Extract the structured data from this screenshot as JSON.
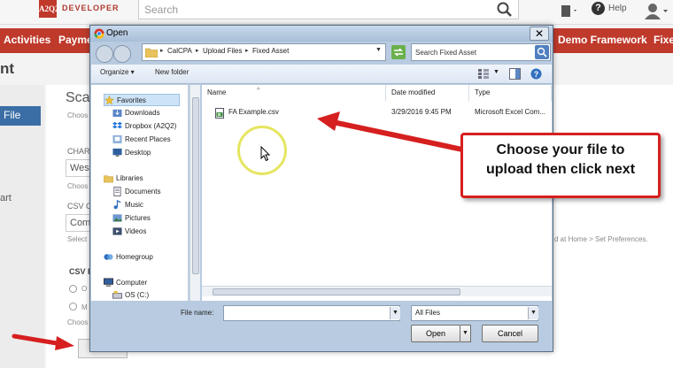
{
  "app": {
    "logo_mark": "A2Q2",
    "logo_text": "DEVELOPER",
    "search_placeholder": "Search",
    "help_label": "Help"
  },
  "nav": {
    "items": [
      "Activities",
      "Payme",
      "Demo Framework",
      "Fixe"
    ]
  },
  "page": {
    "title_fragment": "nt",
    "left_tab_label": "File",
    "left_art_label": "art",
    "section_fragment": "Sca",
    "choose_fragment_1": "Choos",
    "char_label_fragment": "CHAR",
    "char_value_fragment": "West",
    "choose_fragment_2": "Choos",
    "csv_label_fragment": "CSV C",
    "csv_value_fragment": "Com",
    "select_fragment": "Select",
    "csvf_label_fragment": "CSV F",
    "radio1_fragment": "O",
    "radio2_fragment": "M",
    "choose_fragment_3": "Choos",
    "preferences_hint": "d at Home > Set Preferences."
  },
  "dialog": {
    "title": "Open",
    "breadcrumbs": [
      "CalCPA",
      "Upload Files",
      "Fixed Asset"
    ],
    "search_placeholder": "Search Fixed Asset",
    "organize_label": "Organize ▾",
    "new_folder_label": "New folder",
    "nav_items": [
      {
        "label": "Favorites",
        "icon": "star-icon",
        "selected": true
      },
      {
        "label": "Downloads",
        "icon": "downloads-folder-icon"
      },
      {
        "label": "Dropbox (A2Q2)",
        "icon": "dropbox-icon"
      },
      {
        "label": "Recent Places",
        "icon": "recent-places-icon"
      },
      {
        "label": "Desktop",
        "icon": "desktop-icon"
      },
      {
        "label": "Libraries",
        "icon": "libraries-icon"
      },
      {
        "label": "Documents",
        "icon": "documents-icon"
      },
      {
        "label": "Music",
        "icon": "music-icon"
      },
      {
        "label": "Pictures",
        "icon": "pictures-icon"
      },
      {
        "label": "Videos",
        "icon": "videos-icon"
      },
      {
        "label": "Homegroup",
        "icon": "homegroup-icon"
      },
      {
        "label": "Computer",
        "icon": "computer-icon"
      },
      {
        "label": "OS (C:)",
        "icon": "drive-icon"
      }
    ],
    "columns": [
      "Name",
      "Date modified",
      "Type"
    ],
    "files": [
      {
        "name": "FA Example.csv",
        "date_modified": "3/29/2016 9:45 PM",
        "type": "Microsoft Excel Com..."
      }
    ],
    "file_name_label": "File name:",
    "file_name_value": "",
    "file_type_value": "All Files",
    "open_label": "Open",
    "cancel_label": "Cancel"
  },
  "callout": {
    "line1": "Choose your file to",
    "line2": "upload then click next"
  },
  "colors": {
    "nav_red": "#bf3a2b",
    "callout_border": "#d61f1f",
    "arrow_red": "#d61f1f",
    "dialog_frame": "#b8cbe0"
  }
}
